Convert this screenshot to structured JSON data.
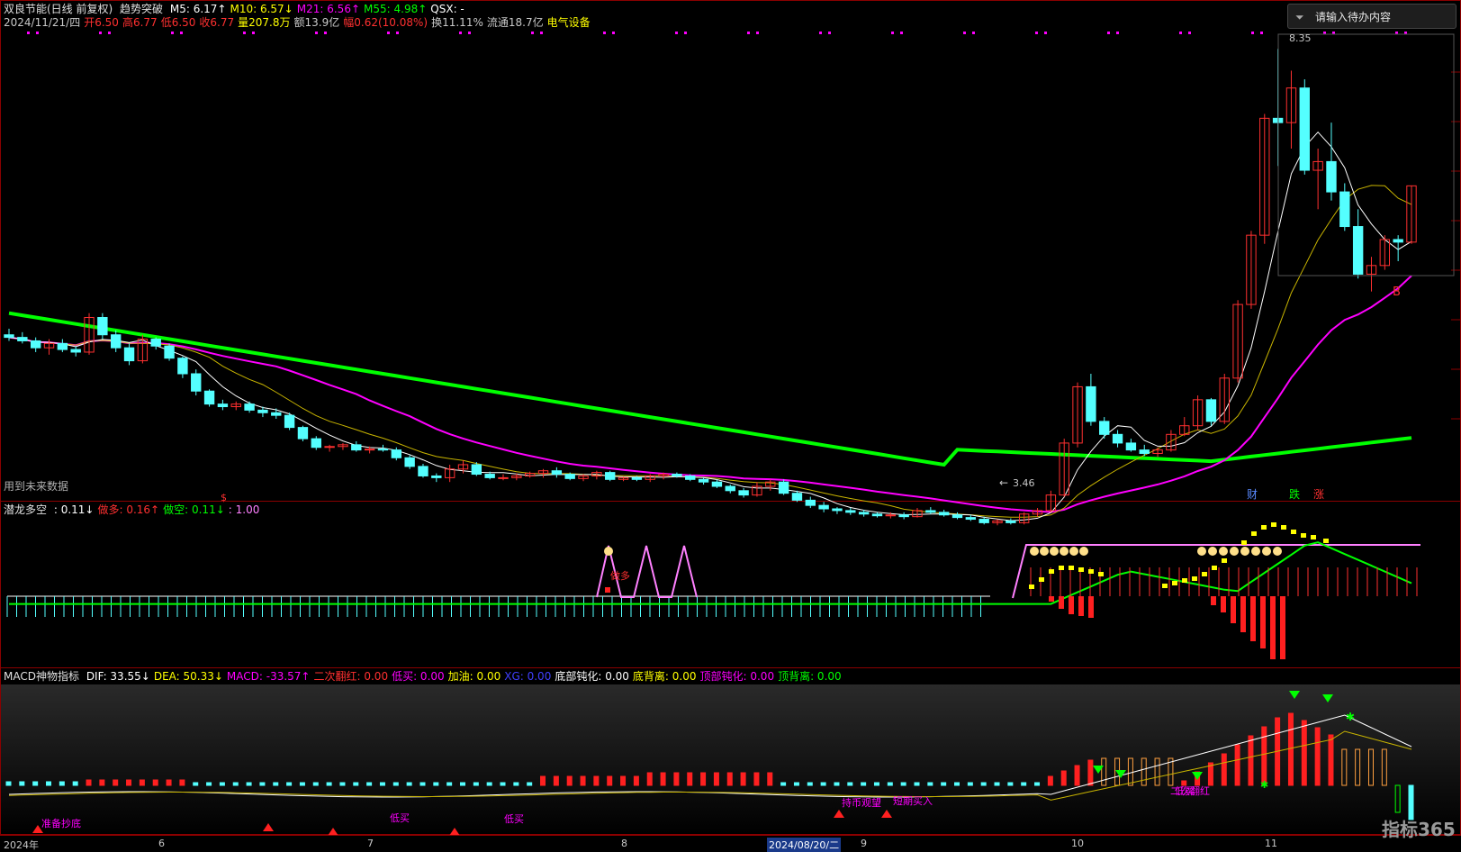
{
  "header": {
    "name": "双良节能(日线 前复权)",
    "indicator": "趋势突破",
    "ma": [
      {
        "label": "M5: 6.17↑",
        "color": "#ffffff"
      },
      {
        "label": "M10: 6.57↓",
        "color": "#ffff00"
      },
      {
        "label": "M21: 6.56↑",
        "color": "#ff00ff"
      },
      {
        "label": "M55: 4.98↑",
        "color": "#00ff00"
      },
      {
        "label": "QSX: -",
        "color": "#ffffff"
      }
    ],
    "line2": [
      {
        "t": "2024/11/21/四",
        "c": "#c8c8c8"
      },
      {
        "t": "开6.50",
        "c": "#ff3030"
      },
      {
        "t": "高6.77",
        "c": "#ff3030"
      },
      {
        "t": "低6.50",
        "c": "#ff3030"
      },
      {
        "t": "收6.77",
        "c": "#ff3030"
      },
      {
        "t": "量207.8万",
        "c": "#ffff00"
      },
      {
        "t": "额13.9亿",
        "c": "#c8c8c8"
      },
      {
        "t": "幅0.62(10.08%)",
        "c": "#ff3030"
      },
      {
        "t": "换11.11%",
        "c": "#c8c8c8"
      },
      {
        "t": "流通18.7亿",
        "c": "#c8c8c8"
      },
      {
        "t": "电气设备",
        "c": "#ffff00"
      }
    ]
  },
  "search": {
    "placeholder": "请输入待办内容"
  },
  "main_notes": {
    "future": "用到未来数据",
    "high": "8.35",
    "low": "3.46",
    "b_mark": "B",
    "dollar": "$",
    "cai": "财",
    "die": "跌",
    "zhang": "涨"
  },
  "panel2": {
    "title": "潜龙多空",
    "items": [
      {
        "t": ": 0.11↓",
        "c": "#ffffff"
      },
      {
        "t": "做多: 0.16↑",
        "c": "#ff3030"
      },
      {
        "t": "做空: 0.11↓",
        "c": "#00ff00"
      },
      {
        "t": ": 1.00",
        "c": "#ff80ff"
      }
    ],
    "zuoduo": "做多"
  },
  "panel3": {
    "title": "MACD神物指标",
    "items": [
      {
        "t": "DIF: 33.55↓",
        "c": "#ffffff"
      },
      {
        "t": "DEA: 50.33↓",
        "c": "#ffff00"
      },
      {
        "t": "MACD: -33.57↑",
        "c": "#ff00ff"
      },
      {
        "t": "二次翻红: 0.00",
        "c": "#ff3030"
      },
      {
        "t": "低买: 0.00",
        "c": "#ff00ff"
      },
      {
        "t": "加油: 0.00",
        "c": "#ffff00"
      },
      {
        "t": "XG: 0.00",
        "c": "#4040ff"
      },
      {
        "t": "底部钝化: 0.00",
        "c": "#ffffff"
      },
      {
        "t": "底背离: 0.00",
        "c": "#ffff00"
      },
      {
        "t": "顶部钝化: 0.00",
        "c": "#ff00ff"
      },
      {
        "t": "顶背离: 0.00",
        "c": "#00ff00"
      }
    ],
    "labels": [
      "准备抄底",
      "低买",
      "低买",
      "低买",
      "持币观望",
      "短期买入",
      "低买",
      "二次翻红"
    ]
  },
  "date_axis": {
    "ticks": [
      {
        "t": "2024年"
      },
      {
        "t": "6"
      },
      {
        "t": "7"
      },
      {
        "t": "8"
      },
      {
        "t": "2024/08/20/二"
      },
      {
        "t": "9"
      },
      {
        "t": "10"
      },
      {
        "t": "11"
      }
    ]
  },
  "watermark": "指标365",
  "chart_data": {
    "type": "candlestick",
    "price_range": [
      3.3,
      8.5
    ],
    "series_colors": {
      "up": "#ff3030",
      "down": "#54ffff",
      "m5": "#ffffff",
      "m10": "#c8b400",
      "m21": "#ff00ff",
      "m55": "#00ff00"
    },
    "candles": [
      [
        5.05,
        5.12,
        4.98,
        5.02
      ],
      [
        5.02,
        5.08,
        4.95,
        4.98
      ],
      [
        4.98,
        5.02,
        4.85,
        4.9
      ],
      [
        4.9,
        5.0,
        4.82,
        4.95
      ],
      [
        4.95,
        5.0,
        4.85,
        4.88
      ],
      [
        4.88,
        4.92,
        4.8,
        4.85
      ],
      [
        4.85,
        5.3,
        4.82,
        5.25
      ],
      [
        5.25,
        5.3,
        5.0,
        5.05
      ],
      [
        5.05,
        5.1,
        4.85,
        4.9
      ],
      [
        4.9,
        4.95,
        4.7,
        4.75
      ],
      [
        4.75,
        5.05,
        4.72,
        5.0
      ],
      [
        5.0,
        5.02,
        4.88,
        4.92
      ],
      [
        4.92,
        4.95,
        4.75,
        4.78
      ],
      [
        4.78,
        4.8,
        4.55,
        4.6
      ],
      [
        4.6,
        4.65,
        4.35,
        4.4
      ],
      [
        4.4,
        4.42,
        4.22,
        4.25
      ],
      [
        4.25,
        4.3,
        4.18,
        4.22
      ],
      [
        4.22,
        4.28,
        4.18,
        4.25
      ],
      [
        4.25,
        4.28,
        4.15,
        4.18
      ],
      [
        4.18,
        4.22,
        4.1,
        4.15
      ],
      [
        4.15,
        4.2,
        4.08,
        4.12
      ],
      [
        4.12,
        4.15,
        3.95,
        3.98
      ],
      [
        3.98,
        4.0,
        3.82,
        3.85
      ],
      [
        3.85,
        3.88,
        3.72,
        3.75
      ],
      [
        3.75,
        3.78,
        3.7,
        3.76
      ],
      [
        3.76,
        3.8,
        3.72,
        3.78
      ],
      [
        3.78,
        3.82,
        3.7,
        3.72
      ],
      [
        3.72,
        3.76,
        3.68,
        3.73
      ],
      [
        3.73,
        3.78,
        3.7,
        3.72
      ],
      [
        3.72,
        3.75,
        3.6,
        3.63
      ],
      [
        3.63,
        3.66,
        3.5,
        3.53
      ],
      [
        3.53,
        3.56,
        3.4,
        3.42
      ],
      [
        3.42,
        3.45,
        3.35,
        3.4
      ],
      [
        3.4,
        3.55,
        3.35,
        3.5
      ],
      [
        3.5,
        3.6,
        3.45,
        3.55
      ],
      [
        3.55,
        3.58,
        3.42,
        3.44
      ],
      [
        3.44,
        3.47,
        3.38,
        3.4
      ],
      [
        3.4,
        3.44,
        3.37,
        3.4
      ],
      [
        3.4,
        3.45,
        3.37,
        3.42
      ],
      [
        3.42,
        3.47,
        3.4,
        3.45
      ],
      [
        3.45,
        3.5,
        3.4,
        3.48
      ],
      [
        3.48,
        3.52,
        3.4,
        3.44
      ],
      [
        3.44,
        3.46,
        3.37,
        3.39
      ],
      [
        3.39,
        3.44,
        3.36,
        3.42
      ],
      [
        3.42,
        3.48,
        3.38,
        3.46
      ],
      [
        3.46,
        3.48,
        3.36,
        3.38
      ],
      [
        3.38,
        3.41,
        3.36,
        3.4
      ],
      [
        3.4,
        3.42,
        3.36,
        3.38
      ],
      [
        3.38,
        3.44,
        3.35,
        3.42
      ],
      [
        3.42,
        3.46,
        3.38,
        3.44
      ],
      [
        3.44,
        3.46,
        3.4,
        3.42
      ],
      [
        3.42,
        3.44,
        3.36,
        3.38
      ],
      [
        3.38,
        3.4,
        3.32,
        3.35
      ],
      [
        3.35,
        3.38,
        3.28,
        3.3
      ],
      [
        3.3,
        3.32,
        3.22,
        3.25
      ],
      [
        3.25,
        3.28,
        3.17,
        3.2
      ],
      [
        3.2,
        3.35,
        3.18,
        3.3
      ],
      [
        3.3,
        3.38,
        3.25,
        3.35
      ],
      [
        3.35,
        3.38,
        3.2,
        3.22
      ],
      [
        3.22,
        3.25,
        3.12,
        3.14
      ],
      [
        3.14,
        3.18,
        3.05,
        3.08
      ],
      [
        3.08,
        3.12,
        3.0,
        3.04
      ],
      [
        3.04,
        3.06,
        2.98,
        3.02
      ],
      [
        3.02,
        3.05,
        2.97,
        3.0
      ],
      [
        3.0,
        3.03,
        2.95,
        2.98
      ],
      [
        2.98,
        3.0,
        2.94,
        2.96
      ],
      [
        2.96,
        3.0,
        2.93,
        2.97
      ],
      [
        2.97,
        3.0,
        2.92,
        2.95
      ],
      [
        2.95,
        3.05,
        2.94,
        3.02
      ],
      [
        3.02,
        3.06,
        2.98,
        3.0
      ],
      [
        3.0,
        3.03,
        2.95,
        2.97
      ],
      [
        2.97,
        3.0,
        2.92,
        2.94
      ],
      [
        2.94,
        2.97,
        2.9,
        2.92
      ],
      [
        2.92,
        2.95,
        2.86,
        2.88
      ],
      [
        2.88,
        2.92,
        2.85,
        2.9
      ],
      [
        2.9,
        2.93,
        2.86,
        2.88
      ],
      [
        2.88,
        3.0,
        2.86,
        2.98
      ],
      [
        2.98,
        3.05,
        2.95,
        3.02
      ],
      [
        3.02,
        3.25,
        3.0,
        3.2
      ],
      [
        3.2,
        3.85,
        3.18,
        3.8
      ],
      [
        3.8,
        4.5,
        3.75,
        4.45
      ],
      [
        4.45,
        4.6,
        4.0,
        4.05
      ],
      [
        4.05,
        4.1,
        3.85,
        3.9
      ],
      [
        3.9,
        3.95,
        3.75,
        3.8
      ],
      [
        3.8,
        3.85,
        3.7,
        3.72
      ],
      [
        3.72,
        3.78,
        3.65,
        3.68
      ],
      [
        3.68,
        3.75,
        3.64,
        3.72
      ],
      [
        3.72,
        3.95,
        3.7,
        3.9
      ],
      [
        3.9,
        4.1,
        3.88,
        4.0
      ],
      [
        4.0,
        4.35,
        3.95,
        4.3
      ],
      [
        4.3,
        4.32,
        4.0,
        4.05
      ],
      [
        4.05,
        4.6,
        4.02,
        4.55
      ],
      [
        4.55,
        5.45,
        4.5,
        5.4
      ],
      [
        5.4,
        6.25,
        5.35,
        6.2
      ],
      [
        6.2,
        7.6,
        6.1,
        7.55
      ],
      [
        7.55,
        8.35,
        7.0,
        7.5
      ],
      [
        7.5,
        8.1,
        7.2,
        7.9
      ],
      [
        7.9,
        8.0,
        6.9,
        6.95
      ],
      [
        6.95,
        7.2,
        6.5,
        7.05
      ],
      [
        7.05,
        7.5,
        6.6,
        6.7
      ],
      [
        6.7,
        6.8,
        6.25,
        6.3
      ],
      [
        6.3,
        6.5,
        5.7,
        5.75
      ],
      [
        5.75,
        5.95,
        5.55,
        5.85
      ],
      [
        5.85,
        6.2,
        5.8,
        6.15
      ],
      [
        6.15,
        6.2,
        5.9,
        6.12
      ],
      [
        6.12,
        6.77,
        6.1,
        6.77
      ]
    ]
  }
}
